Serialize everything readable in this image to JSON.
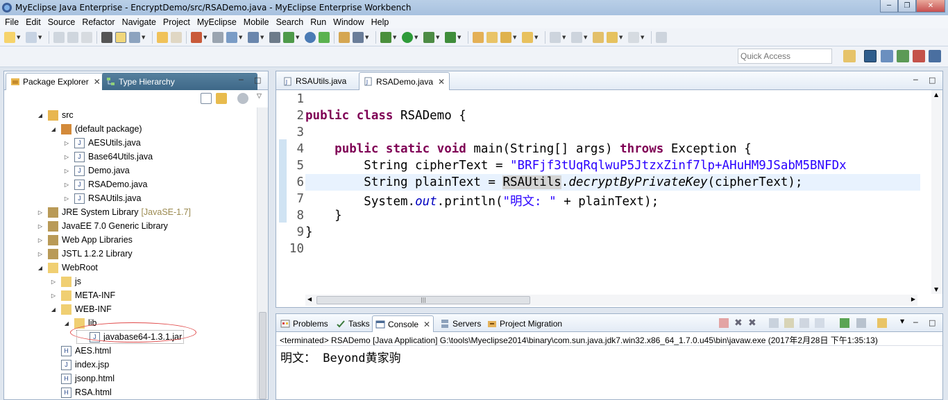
{
  "window": {
    "title": "MyEclipse Java Enterprise - EncryptDemo/src/RSADemo.java - MyEclipse Enterprise Workbench"
  },
  "menu": [
    "File",
    "Edit",
    "Source",
    "Refactor",
    "Navigate",
    "Project",
    "MyEclipse",
    "Mobile",
    "Search",
    "Run",
    "Window",
    "Help"
  ],
  "quick_access": {
    "placeholder": "Quick Access"
  },
  "explorer": {
    "tabs": [
      {
        "label": "Package Explorer",
        "active": true
      },
      {
        "label": "Type Hierarchy",
        "active": false
      }
    ],
    "tree": [
      {
        "label": "src",
        "level": 0,
        "expanded": true,
        "icon": "source-folder-icon"
      },
      {
        "label": "(default package)",
        "level": 1,
        "expanded": true,
        "icon": "package-icon"
      },
      {
        "label": "AESUtils.java",
        "level": 2,
        "icon": "java-file-icon"
      },
      {
        "label": "Base64Utils.java",
        "level": 2,
        "icon": "java-file-icon"
      },
      {
        "label": "Demo.java",
        "level": 2,
        "icon": "java-file-icon"
      },
      {
        "label": "RSADemo.java",
        "level": 2,
        "icon": "java-file-icon"
      },
      {
        "label": "RSAUtils.java",
        "level": 2,
        "icon": "java-file-icon"
      },
      {
        "label": "JRE System Library",
        "decor": "[JavaSE-1.7]",
        "level": 0,
        "icon": "library-icon"
      },
      {
        "label": "JavaEE 7.0 Generic Library",
        "level": 0,
        "icon": "library-icon"
      },
      {
        "label": "Web App Libraries",
        "level": 0,
        "icon": "library-icon"
      },
      {
        "label": "JSTL 1.2.2 Library",
        "level": 0,
        "icon": "library-icon"
      },
      {
        "label": "WebRoot",
        "level": 0,
        "expanded": true,
        "icon": "folder-icon"
      },
      {
        "label": "js",
        "level": 1,
        "icon": "folder-icon"
      },
      {
        "label": "META-INF",
        "level": 1,
        "icon": "folder-icon"
      },
      {
        "label": "WEB-INF",
        "level": 1,
        "expanded": true,
        "icon": "folder-icon"
      },
      {
        "label": "lib",
        "level": 2,
        "expanded": true,
        "icon": "folder-icon"
      },
      {
        "label": "javabase64-1.3.1.jar",
        "level": 3,
        "icon": "jar-file-icon",
        "selected": true
      },
      {
        "label": "AES.html",
        "level": 1,
        "icon": "html-file-icon"
      },
      {
        "label": "index.jsp",
        "level": 1,
        "icon": "jsp-file-icon"
      },
      {
        "label": "jsonp.html",
        "level": 1,
        "icon": "html-file-icon"
      },
      {
        "label": "RSA.html",
        "level": 1,
        "icon": "html-file-icon"
      }
    ]
  },
  "editor": {
    "tabs": [
      {
        "label": "RSAUtils.java",
        "active": false
      },
      {
        "label": "RSADemo.java",
        "active": true
      }
    ],
    "line_numbers": [
      "1",
      "2",
      "3",
      "4",
      "5",
      "6",
      "7",
      "8",
      "9",
      "10"
    ],
    "code": {
      "l2_kw": "public class",
      "l2_rest": " RSADemo {",
      "l4_kw": "public static void",
      "l4_mid": " main(String[] args) ",
      "l4_kw2": "throws",
      "l4_rest": " Exception {",
      "l5_pre": "String cipherText = ",
      "l5_str": "\"BRFjf3tUqRqlwuP5JtzxZinf7lp+AHuHM9JSabM5BNFDx",
      "l6_pre": "String plainText = ",
      "l6_hl": "RSAUtils",
      "l6_dot": ".",
      "l6_method": "decryptByPrivateKey",
      "l6_rest": "(cipherText);",
      "l7_pre": "System.",
      "l7_field": "out",
      "l7_mid": ".println(",
      "l7_str": "\"明文: \"",
      "l7_rest": " + plainText);",
      "l8": "}",
      "l9": "}"
    }
  },
  "console": {
    "tabs": [
      {
        "label": "Problems"
      },
      {
        "label": "Tasks"
      },
      {
        "label": "Console",
        "active": true
      },
      {
        "label": "Servers"
      },
      {
        "label": "Project Migration"
      }
    ],
    "status": "<terminated> RSADemo [Java Application] G:\\tools\\Myeclipse2014\\binary\\com.sun.java.jdk7.win32.x86_64_1.7.0.u45\\bin\\javaw.exe (2017年2月28日 下午1:35:13)",
    "output": "明文： Beyond黄家驹"
  },
  "colors": {
    "keyword": "#7f0055",
    "string": "#2a00ff",
    "field": "#0000c0",
    "annotation": "#e04848"
  }
}
